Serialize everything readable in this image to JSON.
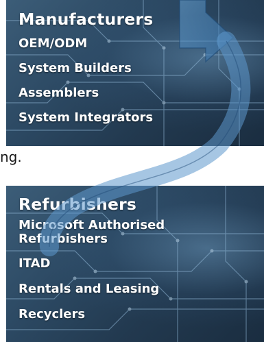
{
  "top_panel": {
    "title": "Manufacturers",
    "items": [
      "OEM/ODM",
      "System Builders",
      "Assemblers",
      "System Integrators"
    ]
  },
  "gap_text": "ng.",
  "bottom_panel": {
    "title": "Refurbishers",
    "items": [
      "Microsoft Authorised",
      "Refurbishers",
      "ITAD",
      "Rentals and Leasing",
      "Recyclers"
    ]
  },
  "colors": {
    "panel_dark": "#22394f",
    "panel_light": "#3c5d78",
    "arrow_fill": "#4a88c0",
    "text": "#ffffff"
  }
}
